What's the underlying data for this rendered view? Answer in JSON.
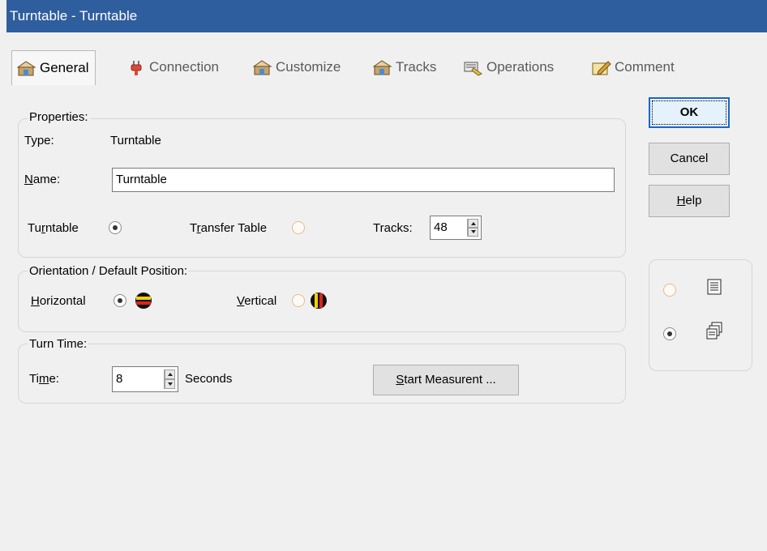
{
  "window": {
    "title": "Turntable - Turntable"
  },
  "tabs": [
    {
      "label": "General",
      "icon": "general-tab-icon",
      "active": true
    },
    {
      "label": "Connection",
      "icon": "plug-icon",
      "active": false
    },
    {
      "label": "Customize",
      "icon": "customize-tab-icon",
      "active": false
    },
    {
      "label": "Tracks",
      "icon": "tracks-tab-icon",
      "active": false
    },
    {
      "label": "Operations",
      "icon": "operations-tab-icon",
      "active": false
    },
    {
      "label": "Comment",
      "icon": "comment-tab-icon",
      "active": false
    }
  ],
  "properties": {
    "title": "Properties:",
    "type_label": "Type:",
    "type_value": "Turntable",
    "name_label_prefix": "",
    "name_label_u": "N",
    "name_label_rest": "ame:",
    "name_value": "Turntable",
    "turntable_label_a": "Tu",
    "turntable_label_u": "r",
    "turntable_label_b": "ntable",
    "turntable_checked": true,
    "transfer_label_a": "T",
    "transfer_label_u": "r",
    "transfer_label_b": "ansfer Table",
    "transfer_checked": false,
    "tracks_label": "Tracks:",
    "tracks_value": "48"
  },
  "orientation": {
    "title": "Orientation / Default Position:",
    "horizontal_u": "H",
    "horizontal_rest": "orizontal",
    "horizontal_checked": true,
    "vertical_u": "V",
    "vertical_rest": "ertical",
    "vertical_checked": false
  },
  "turn_time": {
    "title": "Turn Time:",
    "time_label_a": "Ti",
    "time_label_u": "m",
    "time_label_b": "e:",
    "time_value": "8",
    "unit": "Seconds",
    "start_button_u": "S",
    "start_button_rest": "tart Measurent ..."
  },
  "buttons": {
    "ok": "OK",
    "cancel": "Cancel",
    "help_u": "H",
    "help_rest": "elp"
  },
  "view_mode": {
    "list_checked": false,
    "cascade_checked": true
  },
  "colors": {
    "titlebar": "#2f5e9e",
    "accent_blue": "#1a66c4"
  }
}
